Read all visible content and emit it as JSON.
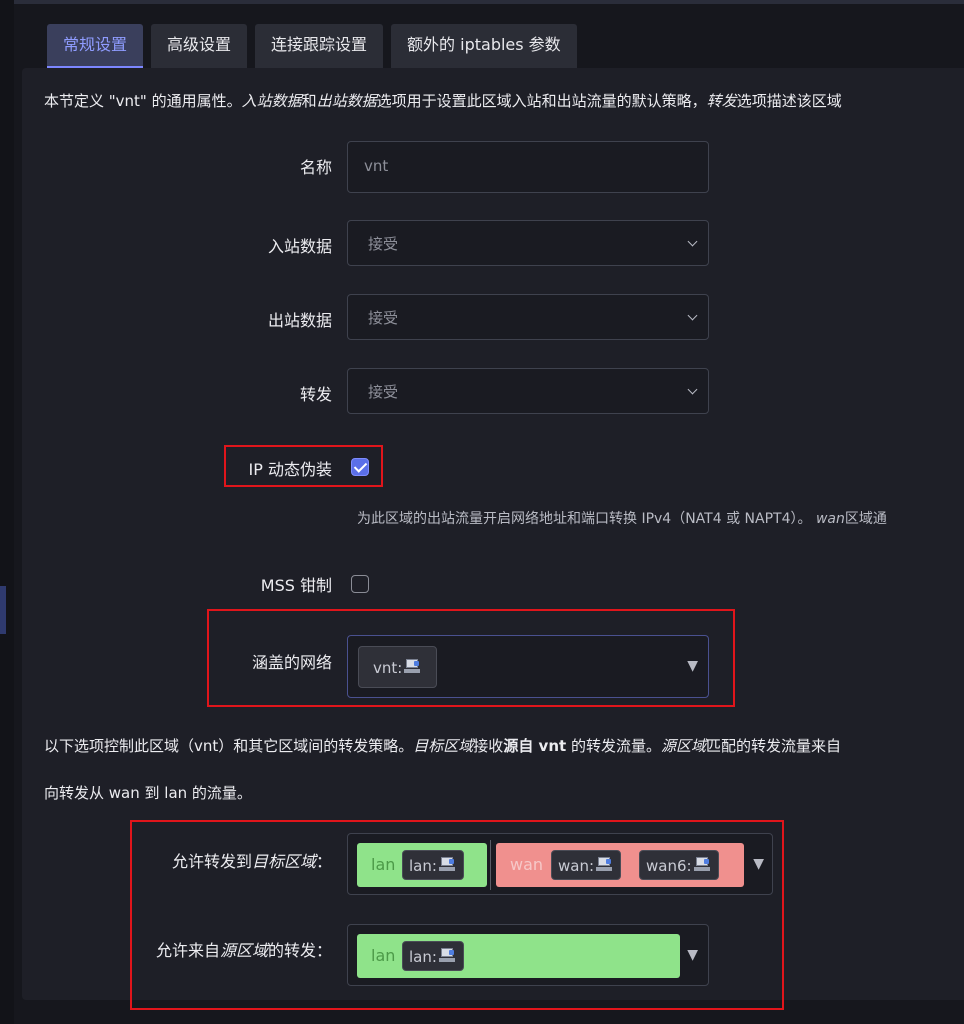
{
  "tabs": [
    {
      "label": "常规设置",
      "active": true
    },
    {
      "label": "高级设置",
      "active": false
    },
    {
      "label": "连接跟踪设置",
      "active": false
    },
    {
      "label": "额外的 iptables 参数",
      "active": false
    }
  ],
  "intro": {
    "p1": "本节定义 \"vnt\" 的通用属性。",
    "inbound": "入站数据",
    "and": "和",
    "outbound": "出站数据",
    "p2": "选项用于设置此区域入站和出站流量的默认策略，",
    "forward": "转发",
    "p3": "选项描述该区域"
  },
  "form": {
    "name": {
      "label": "名称",
      "placeholder": "vnt"
    },
    "input": {
      "label": "入站数据",
      "value": "接受"
    },
    "output": {
      "label": "出站数据",
      "value": "接受"
    },
    "forward": {
      "label": "转发",
      "value": "接受"
    },
    "masq": {
      "label": "IP 动态伪装",
      "checked": true,
      "hint": "为此区域的出站流量开启网络地址和端口转换 IPv4（NAT4 或 NAPT4）。",
      "hint_em": "wan",
      "hint_tail": "区域通"
    },
    "mss": {
      "label": "MSS 钳制",
      "checked": false
    },
    "networks": {
      "label": "涵盖的网络",
      "chips": [
        "vnt:"
      ]
    }
  },
  "forwarding_intro": {
    "t1": "以下选项控制此区域（vnt）和其它区域间的转发策略。",
    "dest": "目标区域",
    "t2": "接收",
    "src_from": "源自 vnt",
    "t3": " 的转发流量。",
    "srczone": "源区域",
    "t4": "匹配的转发流量来自",
    "line2": "向转发从 wan 到 lan 的流量。"
  },
  "forward_to": {
    "label_pre": "允许转发到",
    "label_em": "目标区域",
    "label_post": "：",
    "zones": [
      {
        "name": "lan",
        "color": "#8fe38a",
        "text_color": "#4c9a48",
        "chips": [
          "lan:"
        ]
      },
      {
        "name": "wan",
        "color": "#f0908e",
        "text_color": "#f6c8c8",
        "chips": [
          "wan:",
          "wan6:"
        ]
      }
    ]
  },
  "forward_from": {
    "label_pre": "允许来自",
    "label_em": "源区域",
    "label_post": "的转发：",
    "zones": [
      {
        "name": "lan",
        "color": "#8fe38a",
        "text_color": "#4c9a48",
        "chips": [
          "lan:"
        ]
      }
    ]
  },
  "icons": {
    "dropdown": "▼"
  },
  "colors": {
    "accent": "#7c86ff",
    "highlight_box": "#e0151b"
  }
}
